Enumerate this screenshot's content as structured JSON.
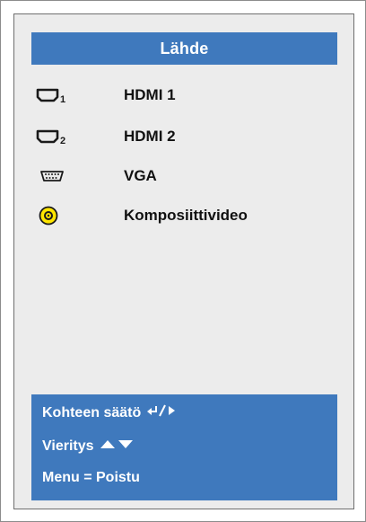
{
  "title": "Lähde",
  "sources": [
    {
      "label": "HDMI 1",
      "icon": "hdmi-1-icon"
    },
    {
      "label": "HDMI 2",
      "icon": "hdmi-2-icon"
    },
    {
      "label": "VGA",
      "icon": "vga-icon"
    },
    {
      "label": "Komposiittivideo",
      "icon": "composite-video-icon"
    }
  ],
  "help": {
    "adjust_label": "Kohteen säätö",
    "scroll_label": "Vieritys",
    "menu_label": "Menu = Poistu"
  },
  "colors": {
    "accent": "#3f79bd",
    "panel": "#ececec",
    "composite_yellow": "#ffe600"
  }
}
